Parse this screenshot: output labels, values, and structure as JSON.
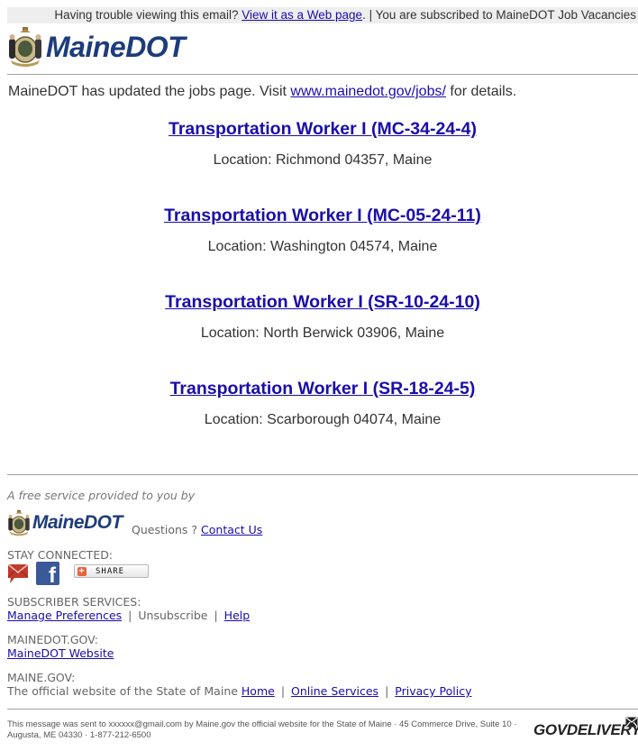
{
  "topbar": {
    "trouble_text": "Having trouble viewing this email?",
    "web_link": "View it as a Web page",
    "subscribed_text": ". | You are subscribed to MaineDOT Job Vacancies"
  },
  "logo": {
    "wordmark": "MaineDOT"
  },
  "intro": {
    "prefix": "MaineDOT has updated the jobs page. Visit ",
    "link": "www.mainedot.gov/jobs/",
    "suffix": " for details."
  },
  "jobs": [
    {
      "title": "Transportation Worker I (MC-34-24-4)",
      "location": "Location: Richmond 04357, Maine"
    },
    {
      "title": "Transportation Worker I (MC-05-24-11)",
      "location": "Location: Washington 04574, Maine"
    },
    {
      "title": "Transportation Worker I (SR-10-24-10)",
      "location": "Location: North Berwick 03906, Maine"
    },
    {
      "title": "Transportation Worker I (SR-18-24-5)",
      "location": "Location: Scarborough 04074, Maine"
    }
  ],
  "footer": {
    "free_service": "A free service provided to you by",
    "questions_label": "Questions ? ",
    "contact_link": "Contact Us",
    "stay_connected": "STAY CONNECTED:",
    "share_label": "SHARE",
    "subscriber_services": {
      "label": "SUBSCRIBER SERVICES:",
      "manage": "Manage Preferences",
      "unsubscribe": "Unsubscribe",
      "help": "Help"
    },
    "mainedot_gov": {
      "label": "MAINEDOT.GOV:",
      "link": "MaineDOT Website"
    },
    "maine_gov": {
      "label": "MAINE.GOV:",
      "text": "The official website of the State of Maine ",
      "home": "Home",
      "online_services": "Online Services",
      "privacy": "Privacy Policy"
    },
    "separator": "|",
    "bottom_message": "This message was sent to xxxxxx@gmail.com by Maine.gov the official website for the State of Maine · 45 Commerce Drive, Suite 10 · Augusta, ME 04330 · 1-877-212-6500",
    "govdelivery": "GOVDELIVERY"
  },
  "colors": {
    "link": "#1a0dab",
    "brand_blue": "#1d3c7a",
    "topbar_bg": "#eeeeee",
    "facebook": "#3b5998",
    "mail_red": "#c0392b"
  }
}
